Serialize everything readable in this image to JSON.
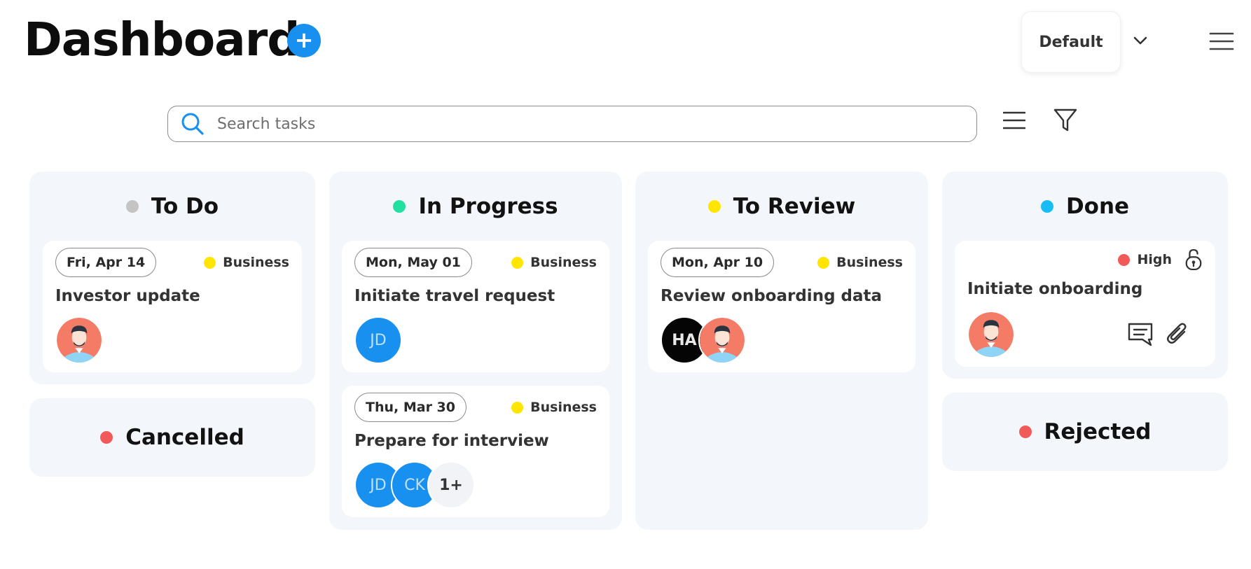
{
  "header": {
    "title": "Dashboard",
    "add_label": "+",
    "view_select": "Default"
  },
  "search": {
    "placeholder": "Search tasks"
  },
  "colors": {
    "accent": "#1890f0",
    "grey": "#c4c4c4",
    "green": "#22e0a0",
    "yellow": "#ffe500",
    "cyan": "#19bdf5",
    "red": "#f25a5a"
  },
  "columns": {
    "todo": {
      "title": "To Do",
      "cards": [
        {
          "date": "Fri, Apr 14",
          "tag": "Business",
          "title": "Investor update"
        }
      ]
    },
    "in_progress": {
      "title": "In Progress",
      "cards": [
        {
          "date": "Mon, May 01",
          "tag": "Business",
          "title": "Initiate travel request",
          "avatars": [
            "JD"
          ]
        },
        {
          "date": "Thu, Mar 30",
          "tag": "Business",
          "title": "Prepare for interview",
          "avatars": [
            "JD",
            "CK"
          ],
          "more": "1+"
        }
      ]
    },
    "to_review": {
      "title": "To Review",
      "cards": [
        {
          "date": "Mon, Apr 10",
          "tag": "Business",
          "title": "Review onboarding data",
          "avatars": [
            "HA"
          ]
        }
      ]
    },
    "done": {
      "title": "Done",
      "cards": [
        {
          "priority": "High",
          "title": "Initiate onboarding"
        }
      ]
    },
    "cancelled": {
      "title": "Cancelled"
    },
    "rejected": {
      "title": "Rejected"
    }
  }
}
